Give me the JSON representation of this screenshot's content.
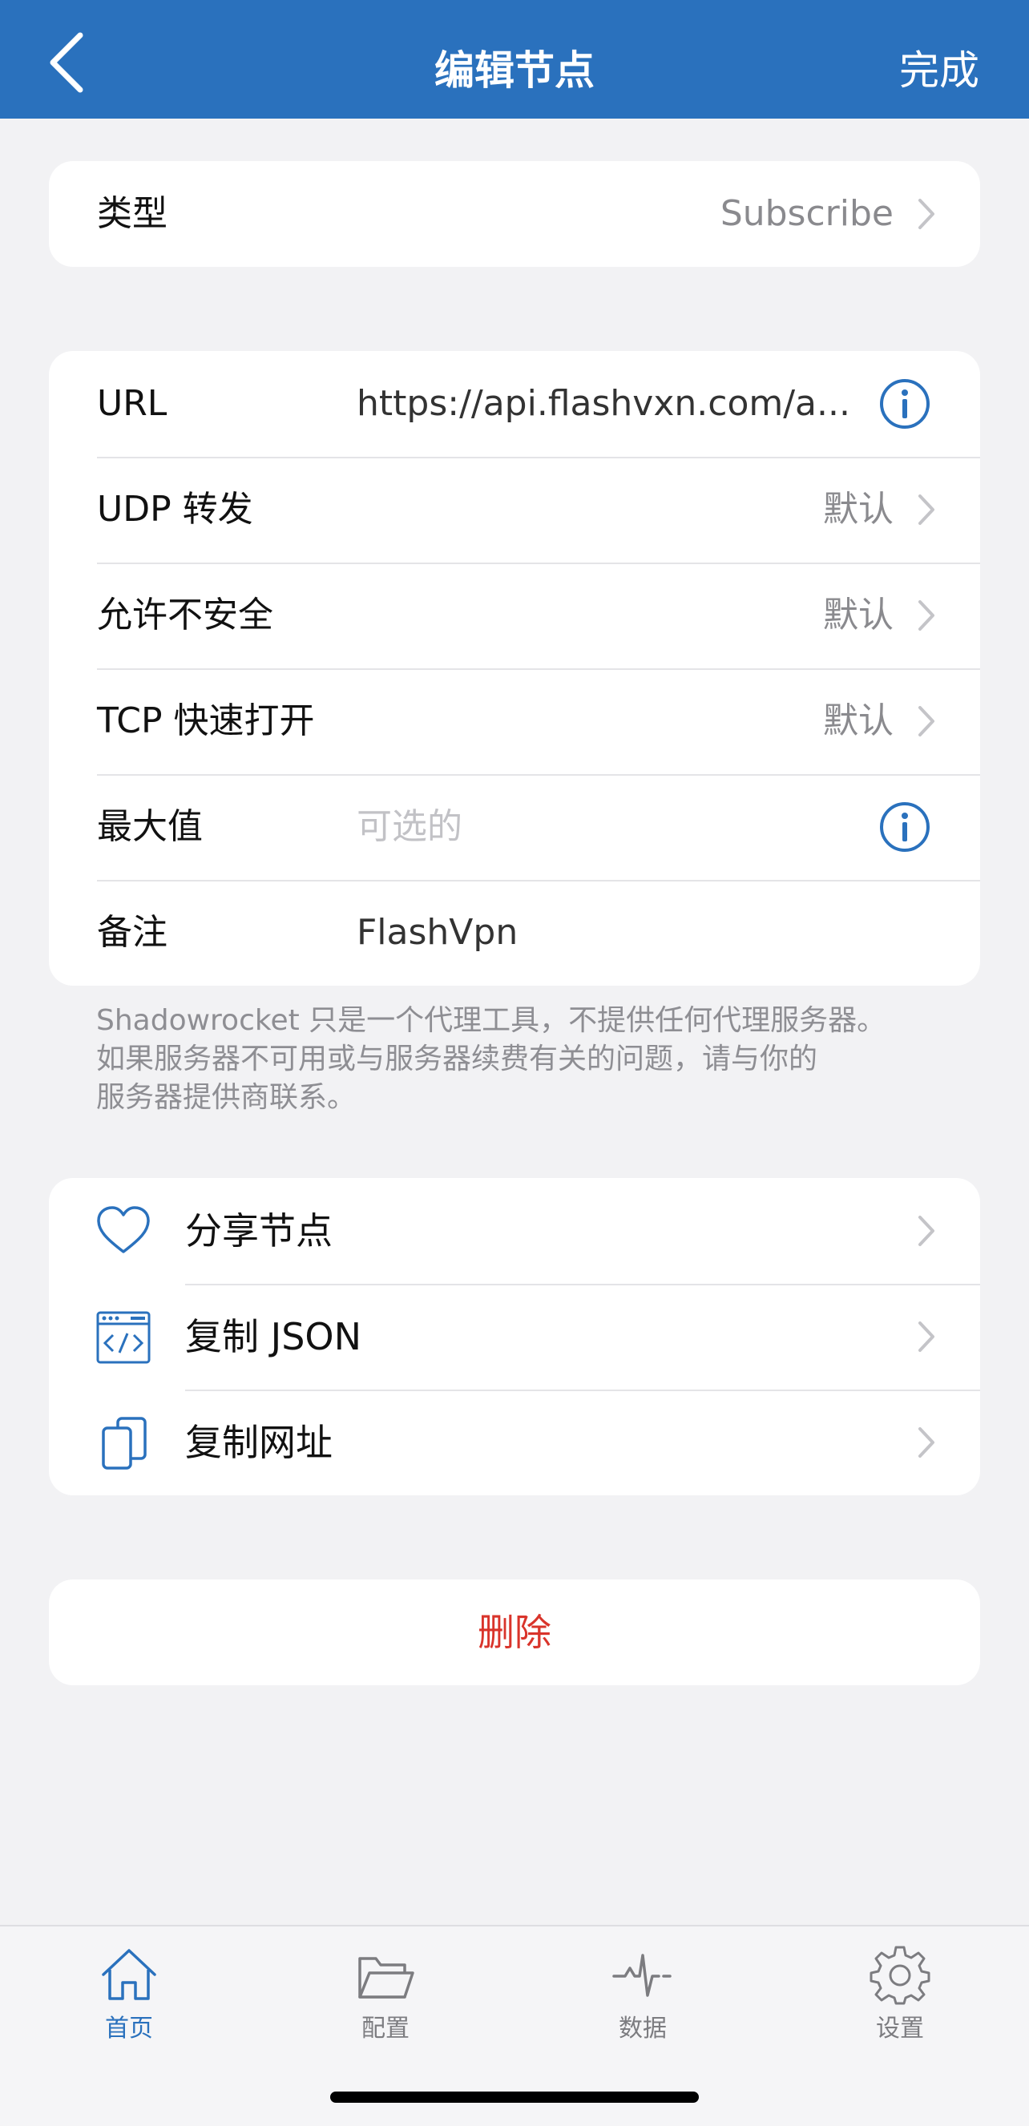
{
  "nav": {
    "title": "编辑节点",
    "done_label": "完成",
    "back_icon": "chevron-left-icon"
  },
  "type_row": {
    "label": "类型",
    "value": "Subscribe"
  },
  "settings": {
    "url": {
      "label": "URL",
      "value": "https://api.flashvxn.com/a..."
    },
    "udp": {
      "label": "UDP 转发",
      "value": "默认"
    },
    "insecure": {
      "label": "允许不安全",
      "value": "默认"
    },
    "tfo": {
      "label": "TCP 快速打开",
      "value": "默认"
    },
    "max": {
      "label": "最大值",
      "placeholder": "可选的"
    },
    "remark": {
      "label": "备注",
      "value": "FlashVpn"
    }
  },
  "note": {
    "line1": "Shadowrocket 只是一个代理工具，不提供任何代理服务器。",
    "line2": "如果服务器不可用或与服务器续费有关的问题，请与你的",
    "line3": "服务器提供商联系。"
  },
  "actions": [
    {
      "label": "分享节点",
      "icon": "heart-icon"
    },
    {
      "label": "复制 JSON",
      "icon": "code-window-icon"
    },
    {
      "label": "复制网址",
      "icon": "copy-icon"
    }
  ],
  "delete_label": "删除",
  "tabbar": {
    "tabs": [
      {
        "label": "首页",
        "icon": "home-icon",
        "active": true
      },
      {
        "label": "配置",
        "icon": "folder-icon",
        "active": false
      },
      {
        "label": "数据",
        "icon": "activity-icon",
        "active": false
      },
      {
        "label": "设置",
        "icon": "gear-icon",
        "active": false
      }
    ]
  },
  "colors": {
    "accent": "#2a71bd",
    "destructive": "#d9342b",
    "background": "#f2f2f4"
  }
}
